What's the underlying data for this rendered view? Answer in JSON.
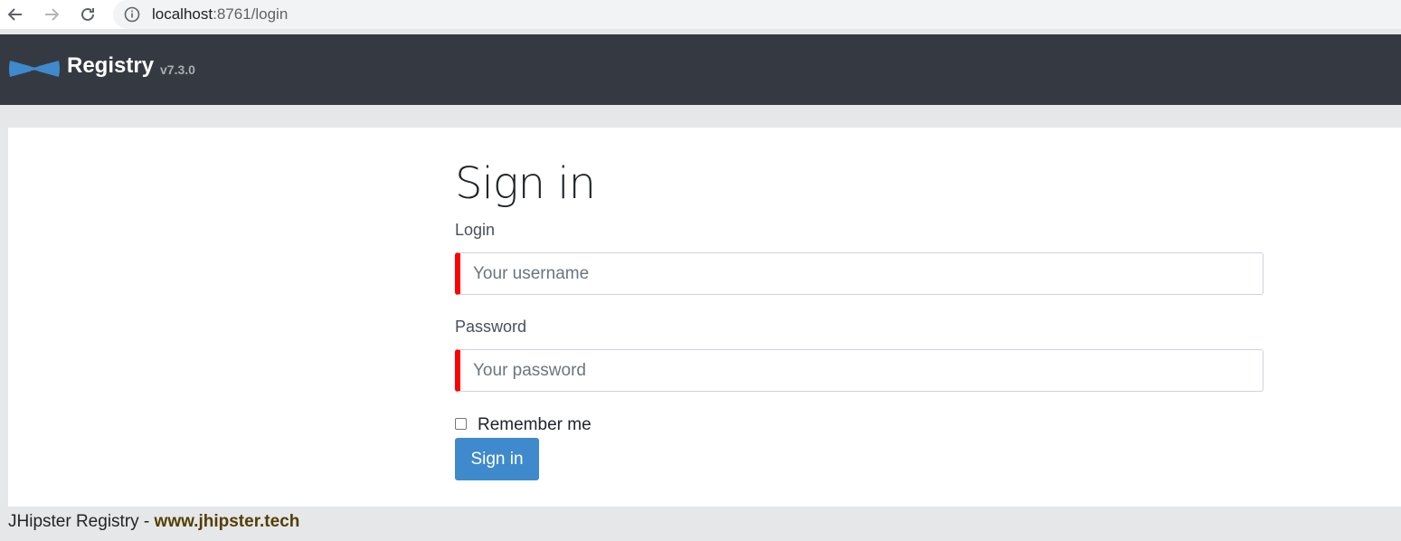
{
  "browser": {
    "url_host": "localhost",
    "url_path": ":8761/login"
  },
  "navbar": {
    "brand": "Registry",
    "version": "v7.3.0",
    "logo_icon": "bowtie-logo-icon",
    "logo_color": "#3e8acc",
    "background": "#353a42"
  },
  "login": {
    "title": "Sign in",
    "login_label": "Login",
    "username_placeholder": "Your username",
    "password_label": "Password",
    "password_placeholder": "Your password",
    "remember_label": "Remember me",
    "remember_checked": false,
    "submit_label": "Sign in",
    "invalid_color": "#ff0000",
    "button_color": "#3e8acc"
  },
  "footer": {
    "text": "JHipster Registry",
    "separator": " - ",
    "link": "www.jhipster.tech"
  }
}
